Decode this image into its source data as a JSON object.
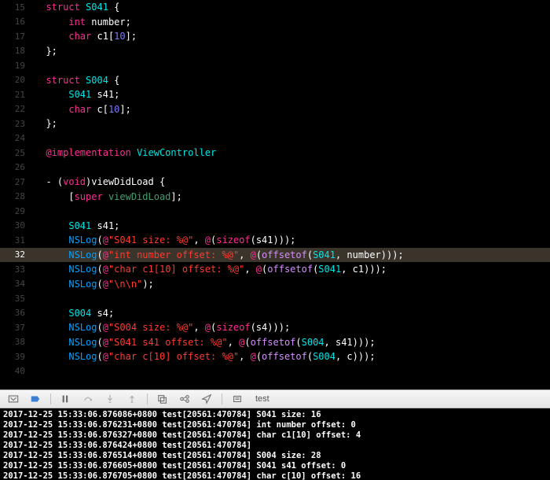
{
  "editor": {
    "highlighted_line": 32,
    "lines": [
      {
        "n": 15,
        "tokens": [
          [
            "plain",
            "  "
          ],
          [
            "keyword",
            "struct"
          ],
          [
            "plain",
            " "
          ],
          [
            "type",
            "S041"
          ],
          [
            "plain",
            " {"
          ]
        ]
      },
      {
        "n": 16,
        "tokens": [
          [
            "plain",
            "      "
          ],
          [
            "keyword",
            "int"
          ],
          [
            "plain",
            " number;"
          ]
        ]
      },
      {
        "n": 17,
        "tokens": [
          [
            "plain",
            "      "
          ],
          [
            "keyword",
            "char"
          ],
          [
            "plain",
            " c1["
          ],
          [
            "num",
            "10"
          ],
          [
            "plain",
            "];"
          ]
        ]
      },
      {
        "n": 18,
        "tokens": [
          [
            "plain",
            "  };"
          ]
        ]
      },
      {
        "n": 19,
        "tokens": []
      },
      {
        "n": 20,
        "tokens": [
          [
            "plain",
            "  "
          ],
          [
            "keyword",
            "struct"
          ],
          [
            "plain",
            " "
          ],
          [
            "type",
            "S004"
          ],
          [
            "plain",
            " {"
          ]
        ]
      },
      {
        "n": 21,
        "tokens": [
          [
            "plain",
            "      "
          ],
          [
            "type",
            "S041"
          ],
          [
            "plain",
            " s41;"
          ]
        ]
      },
      {
        "n": 22,
        "tokens": [
          [
            "plain",
            "      "
          ],
          [
            "keyword",
            "char"
          ],
          [
            "plain",
            " c["
          ],
          [
            "num",
            "10"
          ],
          [
            "plain",
            "];"
          ]
        ]
      },
      {
        "n": 23,
        "tokens": [
          [
            "plain",
            "  };"
          ]
        ]
      },
      {
        "n": 24,
        "tokens": []
      },
      {
        "n": 25,
        "tokens": [
          [
            "plain",
            "  "
          ],
          [
            "at",
            "@implementation"
          ],
          [
            "plain",
            " "
          ],
          [
            "type",
            "ViewController"
          ]
        ]
      },
      {
        "n": 26,
        "tokens": []
      },
      {
        "n": 27,
        "tokens": [
          [
            "plain",
            "  - ("
          ],
          [
            "keyword",
            "void"
          ],
          [
            "plain",
            ")viewDidLoad {"
          ]
        ]
      },
      {
        "n": 28,
        "tokens": [
          [
            "plain",
            "      ["
          ],
          [
            "keyword",
            "super"
          ],
          [
            "plain",
            " "
          ],
          [
            "prop",
            "viewDidLoad"
          ],
          [
            "plain",
            "];"
          ]
        ]
      },
      {
        "n": 29,
        "tokens": []
      },
      {
        "n": 30,
        "tokens": [
          [
            "plain",
            "      "
          ],
          [
            "type",
            "S041"
          ],
          [
            "plain",
            " s41;"
          ]
        ]
      },
      {
        "n": 31,
        "tokens": [
          [
            "plain",
            "      "
          ],
          [
            "func",
            "NSLog"
          ],
          [
            "plain",
            "("
          ],
          [
            "at",
            "@"
          ],
          [
            "str",
            "\"S041 size: %@\""
          ],
          [
            "plain",
            ", "
          ],
          [
            "at",
            "@"
          ],
          [
            "plain",
            "("
          ],
          [
            "keyword",
            "sizeof"
          ],
          [
            "plain",
            "(s41)));"
          ]
        ]
      },
      {
        "n": 32,
        "tokens": [
          [
            "plain",
            "      "
          ],
          [
            "func",
            "NSLog"
          ],
          [
            "plain",
            "("
          ],
          [
            "at",
            "@"
          ],
          [
            "str",
            "\"int number offset: %@\""
          ],
          [
            "plain",
            ", "
          ],
          [
            "at",
            "@"
          ],
          [
            "plain",
            "("
          ],
          [
            "macro",
            "offsetof"
          ],
          [
            "plain",
            "("
          ],
          [
            "type",
            "S041"
          ],
          [
            "plain",
            ", number)));"
          ]
        ]
      },
      {
        "n": 33,
        "tokens": [
          [
            "plain",
            "      "
          ],
          [
            "func",
            "NSLog"
          ],
          [
            "plain",
            "("
          ],
          [
            "at",
            "@"
          ],
          [
            "str",
            "\"char c1[10] offset: %@\""
          ],
          [
            "plain",
            ", "
          ],
          [
            "at",
            "@"
          ],
          [
            "plain",
            "("
          ],
          [
            "macro",
            "offsetof"
          ],
          [
            "plain",
            "("
          ],
          [
            "type",
            "S041"
          ],
          [
            "plain",
            ", c1)));"
          ]
        ]
      },
      {
        "n": 34,
        "tokens": [
          [
            "plain",
            "      "
          ],
          [
            "func",
            "NSLog"
          ],
          [
            "plain",
            "("
          ],
          [
            "at",
            "@"
          ],
          [
            "str",
            "\"\\n\\n\""
          ],
          [
            "plain",
            ");"
          ]
        ]
      },
      {
        "n": 35,
        "tokens": []
      },
      {
        "n": 36,
        "tokens": [
          [
            "plain",
            "      "
          ],
          [
            "type",
            "S004"
          ],
          [
            "plain",
            " s4;"
          ]
        ]
      },
      {
        "n": 37,
        "tokens": [
          [
            "plain",
            "      "
          ],
          [
            "func",
            "NSLog"
          ],
          [
            "plain",
            "("
          ],
          [
            "at",
            "@"
          ],
          [
            "str",
            "\"S004 size: %@\""
          ],
          [
            "plain",
            ", "
          ],
          [
            "at",
            "@"
          ],
          [
            "plain",
            "("
          ],
          [
            "keyword",
            "sizeof"
          ],
          [
            "plain",
            "(s4)));"
          ]
        ]
      },
      {
        "n": 38,
        "tokens": [
          [
            "plain",
            "      "
          ],
          [
            "func",
            "NSLog"
          ],
          [
            "plain",
            "("
          ],
          [
            "at",
            "@"
          ],
          [
            "str",
            "\"S041 s41 offset: %@\""
          ],
          [
            "plain",
            ", "
          ],
          [
            "at",
            "@"
          ],
          [
            "plain",
            "("
          ],
          [
            "macro",
            "offsetof"
          ],
          [
            "plain",
            "("
          ],
          [
            "type",
            "S004"
          ],
          [
            "plain",
            ", s41)));"
          ]
        ]
      },
      {
        "n": 39,
        "tokens": [
          [
            "plain",
            "      "
          ],
          [
            "func",
            "NSLog"
          ],
          [
            "plain",
            "("
          ],
          [
            "at",
            "@"
          ],
          [
            "str",
            "\"char c[10] offset: %@\""
          ],
          [
            "plain",
            ", "
          ],
          [
            "at",
            "@"
          ],
          [
            "plain",
            "("
          ],
          [
            "macro",
            "offsetof"
          ],
          [
            "plain",
            "("
          ],
          [
            "type",
            "S004"
          ],
          [
            "plain",
            ", c)));"
          ]
        ]
      },
      {
        "n": 40,
        "tokens": []
      }
    ]
  },
  "toolbar": {
    "target_label": "test"
  },
  "console": {
    "lines": [
      "2017-12-25 15:33:06.876086+0800 test[20561:470784] S041 size: 16",
      "2017-12-25 15:33:06.876231+0800 test[20561:470784] int number offset: 0",
      "2017-12-25 15:33:06.876327+0800 test[20561:470784] char c1[10] offset: 4",
      "2017-12-25 15:33:06.876424+0800 test[20561:470784]",
      "",
      "2017-12-25 15:33:06.876514+0800 test[20561:470784] S004 size: 28",
      "2017-12-25 15:33:06.876605+0800 test[20561:470784] S041 s41 offset: 0",
      "2017-12-25 15:33:06.876705+0800 test[20561:470784] char c[10] offset: 16"
    ]
  }
}
